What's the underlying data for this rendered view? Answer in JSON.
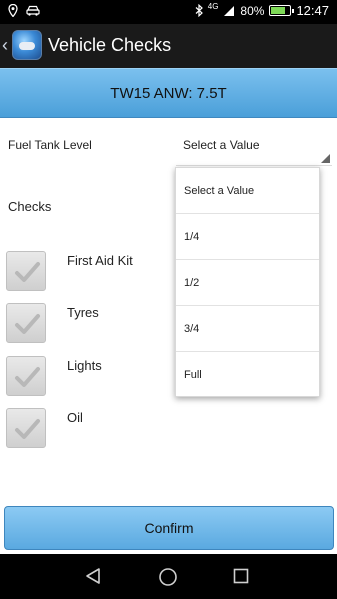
{
  "status_bar": {
    "signal": "4G",
    "battery_percent": "80%",
    "battery_level": 0.8,
    "time": "12:47"
  },
  "action_bar": {
    "title": "Vehicle Checks"
  },
  "header": {
    "vehicle": "TW15 ANW: 7.5T"
  },
  "fuel": {
    "label": "Fuel Tank Level",
    "selected": "Select a Value"
  },
  "checks": {
    "label": "Checks",
    "items": [
      {
        "label": "First Aid Kit"
      },
      {
        "label": "Tyres"
      },
      {
        "label": "Lights"
      },
      {
        "label": "Oil"
      }
    ]
  },
  "dropdown": {
    "options": [
      "Select a Value",
      "1/4",
      "1/2",
      "3/4",
      "Full"
    ]
  },
  "confirm": {
    "label": "Confirm"
  }
}
